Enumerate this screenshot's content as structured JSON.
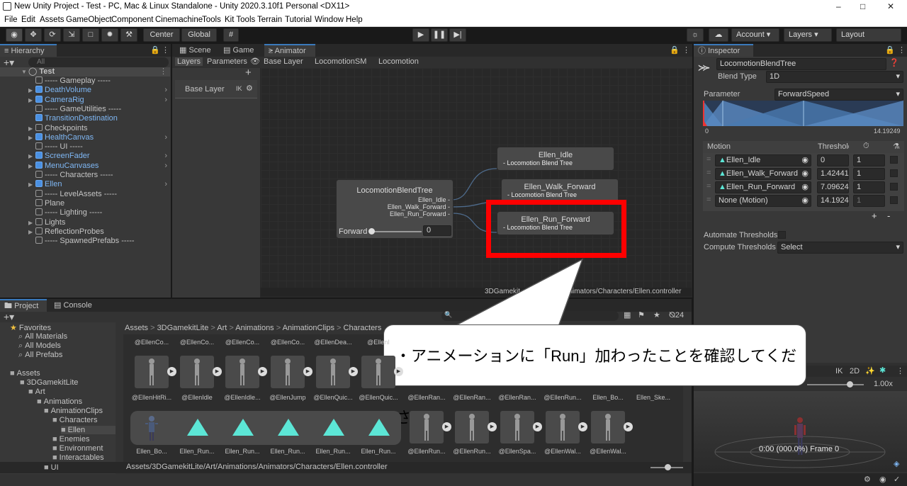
{
  "window": {
    "title": "New Unity Project - Test - PC, Mac & Linux Standalone - Unity 2020.3.10f1 Personal <DX11>"
  },
  "menu": [
    "File",
    "Edit",
    "Assets",
    "GameObject",
    "Component",
    "Cinemachine",
    "Tools",
    "Kit Tools",
    "Terrain",
    "Tutorial",
    "Window",
    "Help"
  ],
  "toolbar": {
    "center": "Center",
    "global": "Global",
    "account": "Account",
    "layers": "Layers",
    "layout": "Layout"
  },
  "hierarchy": {
    "tab": "Hierarchy",
    "search_placeholder": "All",
    "scene": "Test",
    "items": [
      {
        "label": "----- Gameplay -----"
      },
      {
        "label": "DeathVolume"
      },
      {
        "label": "CameraRig"
      },
      {
        "label": "----- GameUtilities -----"
      },
      {
        "label": "TransitionDestination"
      },
      {
        "label": "Checkpoints"
      },
      {
        "label": "HealthCanvas"
      },
      {
        "label": "----- UI -----"
      },
      {
        "label": "ScreenFader"
      },
      {
        "label": "MenuCanvases"
      },
      {
        "label": "----- Characters -----"
      },
      {
        "label": "Ellen"
      },
      {
        "label": "----- LevelAssets -----"
      },
      {
        "label": "Plane"
      },
      {
        "label": "----- Lighting -----"
      },
      {
        "label": "Lights"
      },
      {
        "label": "ReflectionProbes"
      },
      {
        "label": "----- SpawnedPrefabs -----"
      }
    ]
  },
  "animator": {
    "tabs": {
      "scene": "Scene",
      "game": "Game",
      "animator": "Animator"
    },
    "subtabs": {
      "layers": "Layers",
      "parameters": "Parameters"
    },
    "breadcrumb": [
      "Base Layer",
      "LocomotionSM",
      "Locomotion"
    ],
    "base_layer": "Base Layer",
    "ik": "IK",
    "blend_node": {
      "title": "LocomotionBlendTree",
      "outputs": [
        "Ellen_Idle -",
        "Ellen_Walk_Forward -",
        "Ellen_Run_Forward -"
      ],
      "param": "Forward",
      "value": "0"
    },
    "nodes": [
      {
        "title": "Ellen_Idle",
        "sub": "Locomotion Blend Tree"
      },
      {
        "title": "Ellen_Walk_Forward",
        "sub": "Locomotion Blend Tree"
      },
      {
        "title": "Ellen_Run_Forward",
        "sub": "Locomotion Blend Tree"
      }
    ],
    "path_fragments": [
      "3DGamekit",
      "s/Animators/Characters/Ellen.controller"
    ]
  },
  "inspector": {
    "tab": "Inspector",
    "name": "LocomotionBlendTree",
    "blend_type_label": "Blend Type",
    "blend_type": "1D",
    "parameter_label": "Parameter",
    "parameter": "ForwardSpeed",
    "range_min": "0",
    "range_max": "14.19249",
    "motion_header": "Motion",
    "threshold_header": "Threshold",
    "motions": [
      {
        "name": "Ellen_Idle",
        "threshold": "0",
        "speed": "1"
      },
      {
        "name": "Ellen_Walk_Forward",
        "threshold": "1.42441",
        "speed": "1"
      },
      {
        "name": "Ellen_Run_Forward",
        "threshold": "7.09624",
        "speed": "1"
      },
      {
        "name": "None (Motion)",
        "threshold": "14.1924",
        "speed": "1"
      }
    ],
    "plus": "+",
    "minus": "-",
    "automate": "Automate Thresholds",
    "compute": "Compute Thresholds",
    "compute_value": "Select"
  },
  "project": {
    "tabs": {
      "project": "Project",
      "console": "Console"
    },
    "favorites": "Favorites",
    "fav_items": [
      "All Materials",
      "All Models",
      "All Prefabs"
    ],
    "assets_root": "Assets",
    "tree": [
      "3DGamekitLite",
      "Art",
      "Animations",
      "AnimationClips",
      "Characters",
      "Ellen",
      "Enemies",
      "Environment",
      "Interactables",
      "UI"
    ],
    "breadcrumb": [
      "Assets",
      "3DGamekitLite",
      "Art",
      "Animations",
      "AnimationClips",
      "Characters"
    ],
    "row1_labels": [
      "@EllenCo...",
      "@EllenCo...",
      "@EllenCo...",
      "@EllenCo...",
      "@EllenDea...",
      "@EllenI"
    ],
    "row2_labels": [
      "@EllenHitRi...",
      "@EllenIdle",
      "@EllenIdle...",
      "@EllenJump",
      "@EllenQuic...",
      "@EllenQuic...",
      "@EllenRan...",
      "@EllenRan...",
      "@EllenRan...",
      "@EllenRun...",
      "Ellen_Bo...",
      "Ellen_Ske..."
    ],
    "row3_labels": [
      "Ellen_Bo...",
      "Ellen_Run...",
      "Ellen_Run...",
      "Ellen_Run...",
      "Ellen_Run...",
      "Ellen_Run...",
      "@EllenRun...",
      "@EllenRun...",
      "@EllenSpa...",
      "@EllenWal...",
      "@EllenWal..."
    ],
    "count": "24",
    "footer_path": "Assets/3DGamekitLite/Art/Animations/Animators/Characters/Ellen.controller"
  },
  "preview": {
    "ik": "IK",
    "twod": "2D",
    "speed": "1.00x",
    "frame": "0:00 (000.0%) Frame 0"
  },
  "callout": {
    "text": "・アニメーションに「Run」加わったことを確認してください"
  },
  "colors": {
    "highlight": "#ff0000",
    "accent": "#3a79bb",
    "blend": "#5ce6d6"
  }
}
